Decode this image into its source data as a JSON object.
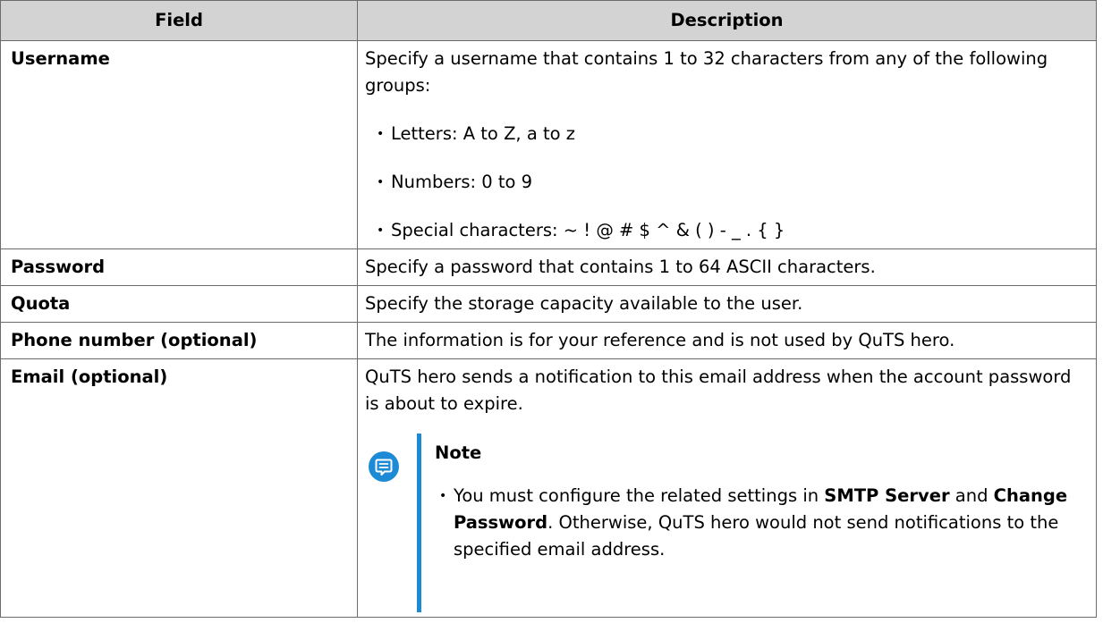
{
  "table": {
    "headers": [
      "Field",
      "Description"
    ],
    "rows": [
      {
        "field": "Username",
        "desc": "Specify a username that contains 1 to 32 characters from any of the following groups:",
        "bullets": [
          "Letters: A to Z, a to z",
          "Numbers: 0 to 9",
          "Special characters: ~ ! @ # $ ^ & ( ) - _ . { }"
        ]
      },
      {
        "field": "Password",
        "desc": "Specify a password that contains 1 to 64 ASCII characters."
      },
      {
        "field": "Quota",
        "desc": "Specify the storage capacity available to the user."
      },
      {
        "field": "Phone number (optional)",
        "desc": "The information is for your reference and is not used by QuTS hero."
      },
      {
        "field": "Email (optional)",
        "desc": "QuTS hero sends a notification to this email address when the account password is about to expire.",
        "note": {
          "title": "Note",
          "text_1": "You must configure the related settings in ",
          "bold_1": "SMTP Server",
          "text_2": " and ",
          "bold_2": "Change Password",
          "text_3": ". Otherwise, QuTS hero would not send notifications to the specified email address."
        }
      }
    ]
  },
  "colors": {
    "header_bg": "#d3d3d3",
    "note_accent": "#1d8ad6"
  },
  "icons": {
    "note": "note-icon"
  }
}
